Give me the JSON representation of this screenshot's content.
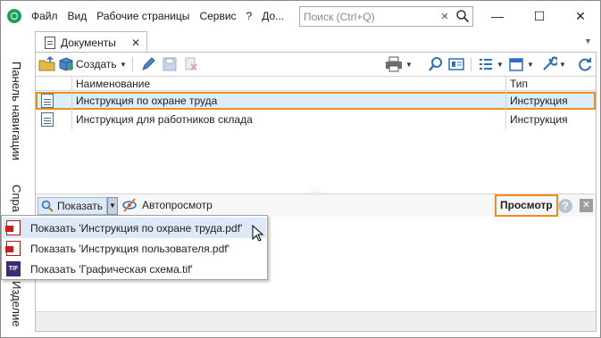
{
  "menu": {
    "items": [
      "Файл",
      "Вид",
      "Рабочие страницы",
      "Сервис",
      "?",
      "До..."
    ]
  },
  "search": {
    "placeholder": "Поиск (Ctrl+Q)"
  },
  "window_controls": {
    "minimize": "—",
    "maximize": "☐",
    "close": "✕"
  },
  "side_panel": {
    "tabs": [
      "Панель навигации",
      "Спра",
      "Изделие"
    ]
  },
  "document_tab": {
    "label": "Документы",
    "close": "✕"
  },
  "toolbar": {
    "create_label": "Создать"
  },
  "grid": {
    "columns": [
      "Наименование",
      "Тип"
    ],
    "rows": [
      {
        "name": "Инструкция по охране труда",
        "type": "Инструкция",
        "selected": true
      },
      {
        "name": "Инструкция для работников склада",
        "type": "Инструкция",
        "selected": false
      }
    ]
  },
  "preview_bar": {
    "show_label": "Показать",
    "autopreview_label": "Автопросмотр",
    "title": "Просмотр",
    "help": "?",
    "close": "✕"
  },
  "dropdown": {
    "items": [
      {
        "label": "Показать 'Инструкция по охране труда.pdf'",
        "icon": "pdf-icon",
        "hover": true
      },
      {
        "label": "Показать 'Инструкция пользователя.pdf'",
        "icon": "pdf-icon",
        "hover": false
      },
      {
        "label": "Показать 'Графическая схема.tif'",
        "icon": "tif-icon",
        "hover": false
      }
    ]
  },
  "colors": {
    "accent_orange": "#f08c1e",
    "selection_blue": "#dceefc",
    "logo_green": "#19a25a",
    "toolbar_blue": "#2f6fc1"
  }
}
